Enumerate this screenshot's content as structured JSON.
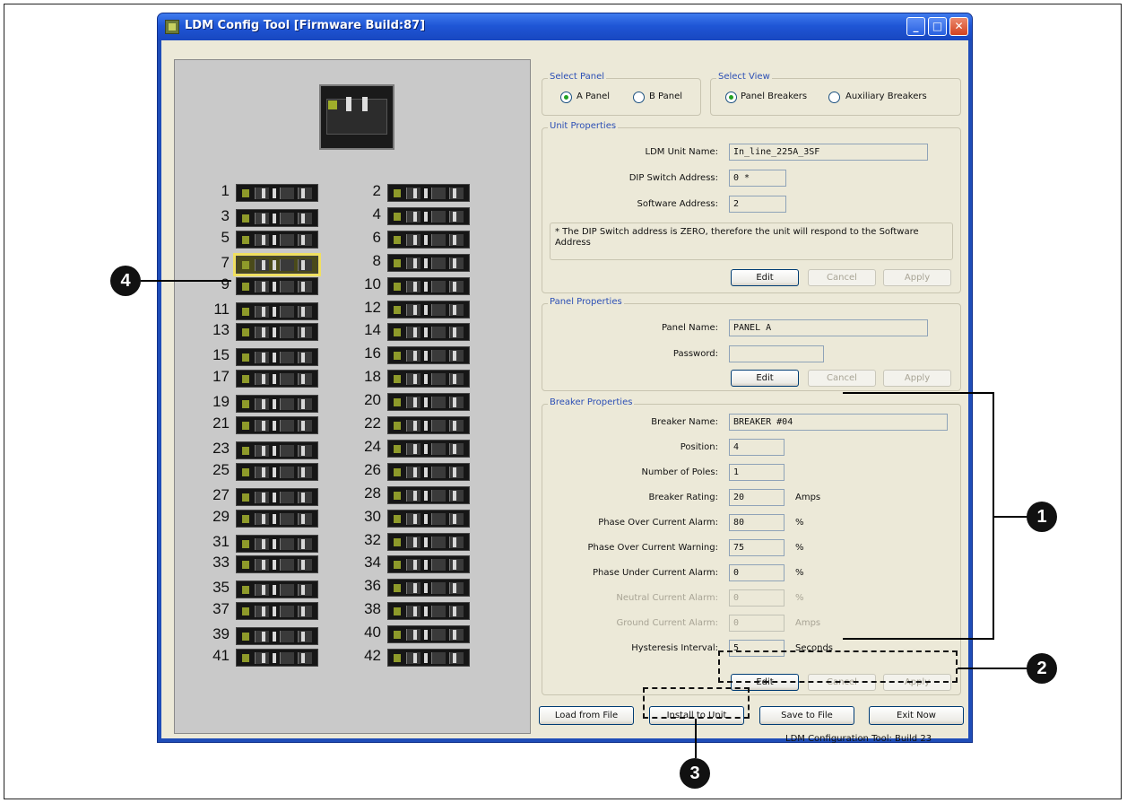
{
  "window": {
    "title": "LDM Config Tool [Firmware Build:87]",
    "min": "_",
    "max": "□",
    "close": "✕"
  },
  "breakers": {
    "left": [
      "1",
      "3",
      "5",
      "7",
      "9",
      "11",
      "13",
      "15",
      "17",
      "19",
      "21",
      "23",
      "25",
      "27",
      "29",
      "31",
      "33",
      "35",
      "37",
      "39",
      "41"
    ],
    "right": [
      "2",
      "4",
      "6",
      "8",
      "10",
      "12",
      "14",
      "16",
      "18",
      "20",
      "22",
      "24",
      "26",
      "28",
      "30",
      "32",
      "34",
      "36",
      "38",
      "40",
      "42"
    ],
    "selected": "7"
  },
  "select_panel": {
    "title": "Select Panel",
    "a": "A Panel",
    "b": "B Panel",
    "selected": "A Panel"
  },
  "select_view": {
    "title": "Select View",
    "panel": "Panel Breakers",
    "aux": "Auxiliary Breakers",
    "selected": "Panel Breakers"
  },
  "unit_props": {
    "title": "Unit Properties",
    "name_label": "LDM Unit Name:",
    "name_value": "In_line_225A_3SF",
    "dip_label": "DIP Switch Address:",
    "dip_value": "0 *",
    "soft_label": "Software Address:",
    "soft_value": "2",
    "note": "* The DIP Switch address is ZERO, therefore the unit will respond to the Software Address",
    "edit": "Edit",
    "cancel": "Cancel",
    "apply": "Apply"
  },
  "panel_props": {
    "title": "Panel Properties",
    "name_label": "Panel Name:",
    "name_value": "PANEL A",
    "pass_label": "Password:",
    "pass_value": "",
    "edit": "Edit",
    "cancel": "Cancel",
    "apply": "Apply"
  },
  "breaker_props": {
    "title": "Breaker Properties",
    "name_label": "Breaker Name:",
    "name_value": "BREAKER #04",
    "pos_label": "Position:",
    "pos_value": "4",
    "poles_label": "Number of Poles:",
    "poles_value": "1",
    "rating_label": "Breaker Rating:",
    "rating_value": "20",
    "rating_unit": "Amps",
    "poca_label": "Phase Over Current Alarm:",
    "poca_value": "80",
    "poca_unit": "%",
    "pocw_label": "Phase Over Current Warning:",
    "pocw_value": "75",
    "pocw_unit": "%",
    "puca_label": "Phase Under Current Alarm:",
    "puca_value": "0",
    "puca_unit": "%",
    "nca_label": "Neutral Current Alarm:",
    "nca_value": "0",
    "nca_unit": "%",
    "gca_label": "Ground Current Alarm:",
    "gca_value": "0",
    "gca_unit": "Amps",
    "hyst_label": "Hysteresis Interval:",
    "hyst_value": "5",
    "hyst_unit": "Seconds",
    "edit": "Edit",
    "cancel": "Cancel",
    "apply": "Apply"
  },
  "footer": {
    "load": "Load from File",
    "install": "Install to Unit",
    "save": "Save to File",
    "exit": "Exit Now",
    "status": "LDM Configuration Tool: Build 23"
  },
  "callouts": {
    "c1": "1",
    "c2": "2",
    "c3": "3",
    "c4": "4"
  }
}
